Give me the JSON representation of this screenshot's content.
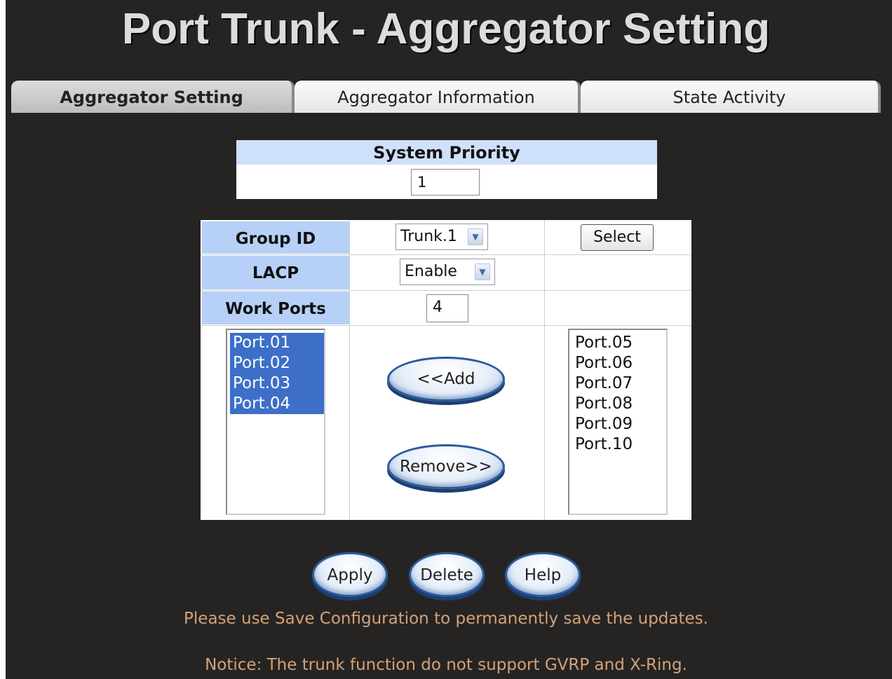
{
  "page": {
    "title": "Port Trunk - Aggregator Setting"
  },
  "tabs": [
    {
      "label": "Aggregator Setting",
      "active": true
    },
    {
      "label": "Aggregator Information",
      "active": false
    },
    {
      "label": "State Activity",
      "active": false
    }
  ],
  "system_priority": {
    "label": "System Priority",
    "value": "1"
  },
  "form": {
    "group_id": {
      "label": "Group ID",
      "value": "Trunk.1",
      "button": "Select"
    },
    "lacp": {
      "label": "LACP",
      "value": "Enable"
    },
    "work_ports": {
      "label": "Work Ports",
      "value": "4"
    }
  },
  "member_ports": [
    {
      "label": "Port.01",
      "selected": true
    },
    {
      "label": "Port.02",
      "selected": true
    },
    {
      "label": "Port.03",
      "selected": true
    },
    {
      "label": "Port.04",
      "selected": true
    }
  ],
  "available_ports": [
    {
      "label": "Port.05"
    },
    {
      "label": "Port.06"
    },
    {
      "label": "Port.07"
    },
    {
      "label": "Port.08"
    },
    {
      "label": "Port.09"
    },
    {
      "label": "Port.10"
    }
  ],
  "transfer": {
    "add": "<<Add",
    "remove": "Remove>>"
  },
  "actions": {
    "apply": "Apply",
    "delete": "Delete",
    "help": "Help"
  },
  "messages": {
    "save_hint": "Please use Save Configuration to permanently save the updates.",
    "notice": "Notice: The trunk function do not support GVRP and X-Ring."
  },
  "colors": {
    "background": "#262423",
    "header_cell": "#b7d0f7",
    "selection": "#3d6fc9",
    "notice_text": "#d3a278"
  }
}
